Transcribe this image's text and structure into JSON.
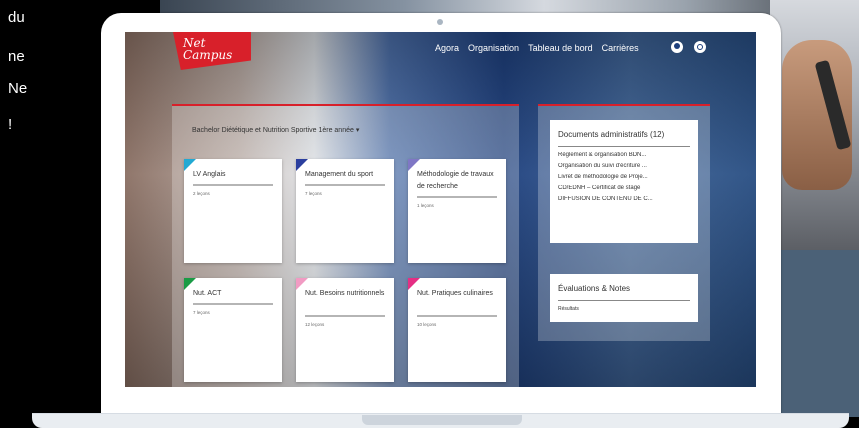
{
  "left_caption": {
    "lines": [
      "du",
      "ne",
      "Ne",
      "!"
    ]
  },
  "app": {
    "logo_text": "Net Campus",
    "nav": [
      "Agora",
      "Organisation",
      "Tableau de bord",
      "Carrières"
    ],
    "course_selector": "Bachelor Diététique et Nutrition Sportive 1ère année ▾",
    "cards": [
      {
        "title": "LV Anglais",
        "count": "2 leçons",
        "accent": "#22a9d3"
      },
      {
        "title": "Management du sport",
        "count": "7 leçons",
        "accent": "#2b3f9e"
      },
      {
        "title": "Méthodologie de travaux de recherche",
        "count": "1 leçons",
        "accent": "#7f77c5"
      },
      {
        "title": "Nut. ACT",
        "count": "7 leçons",
        "accent": "#1a9b45"
      },
      {
        "title": "Nut. Besoins nutritionnels",
        "count": "12 leçons",
        "accent": "#f19bc3"
      },
      {
        "title": "Nut. Pratiques culinaires",
        "count": "10 leçons",
        "accent": "#e52f84"
      }
    ],
    "documents": {
      "title": "Documents administratifs (12)",
      "items": [
        "Règlement & organisation BDN...",
        "Organisation du suivi d'écriture ...",
        "Livret de méthodologie de Proje...",
        "CD/EDNH – Certificat de stage",
        "DIFFUSION DE CONTENU DE C..."
      ]
    },
    "evaluations": {
      "title": "Évaluations & Notes",
      "link": "Résultats"
    }
  },
  "colors": {
    "brand_red": "#d8202a",
    "screen_blue": "#1d3f7d"
  }
}
